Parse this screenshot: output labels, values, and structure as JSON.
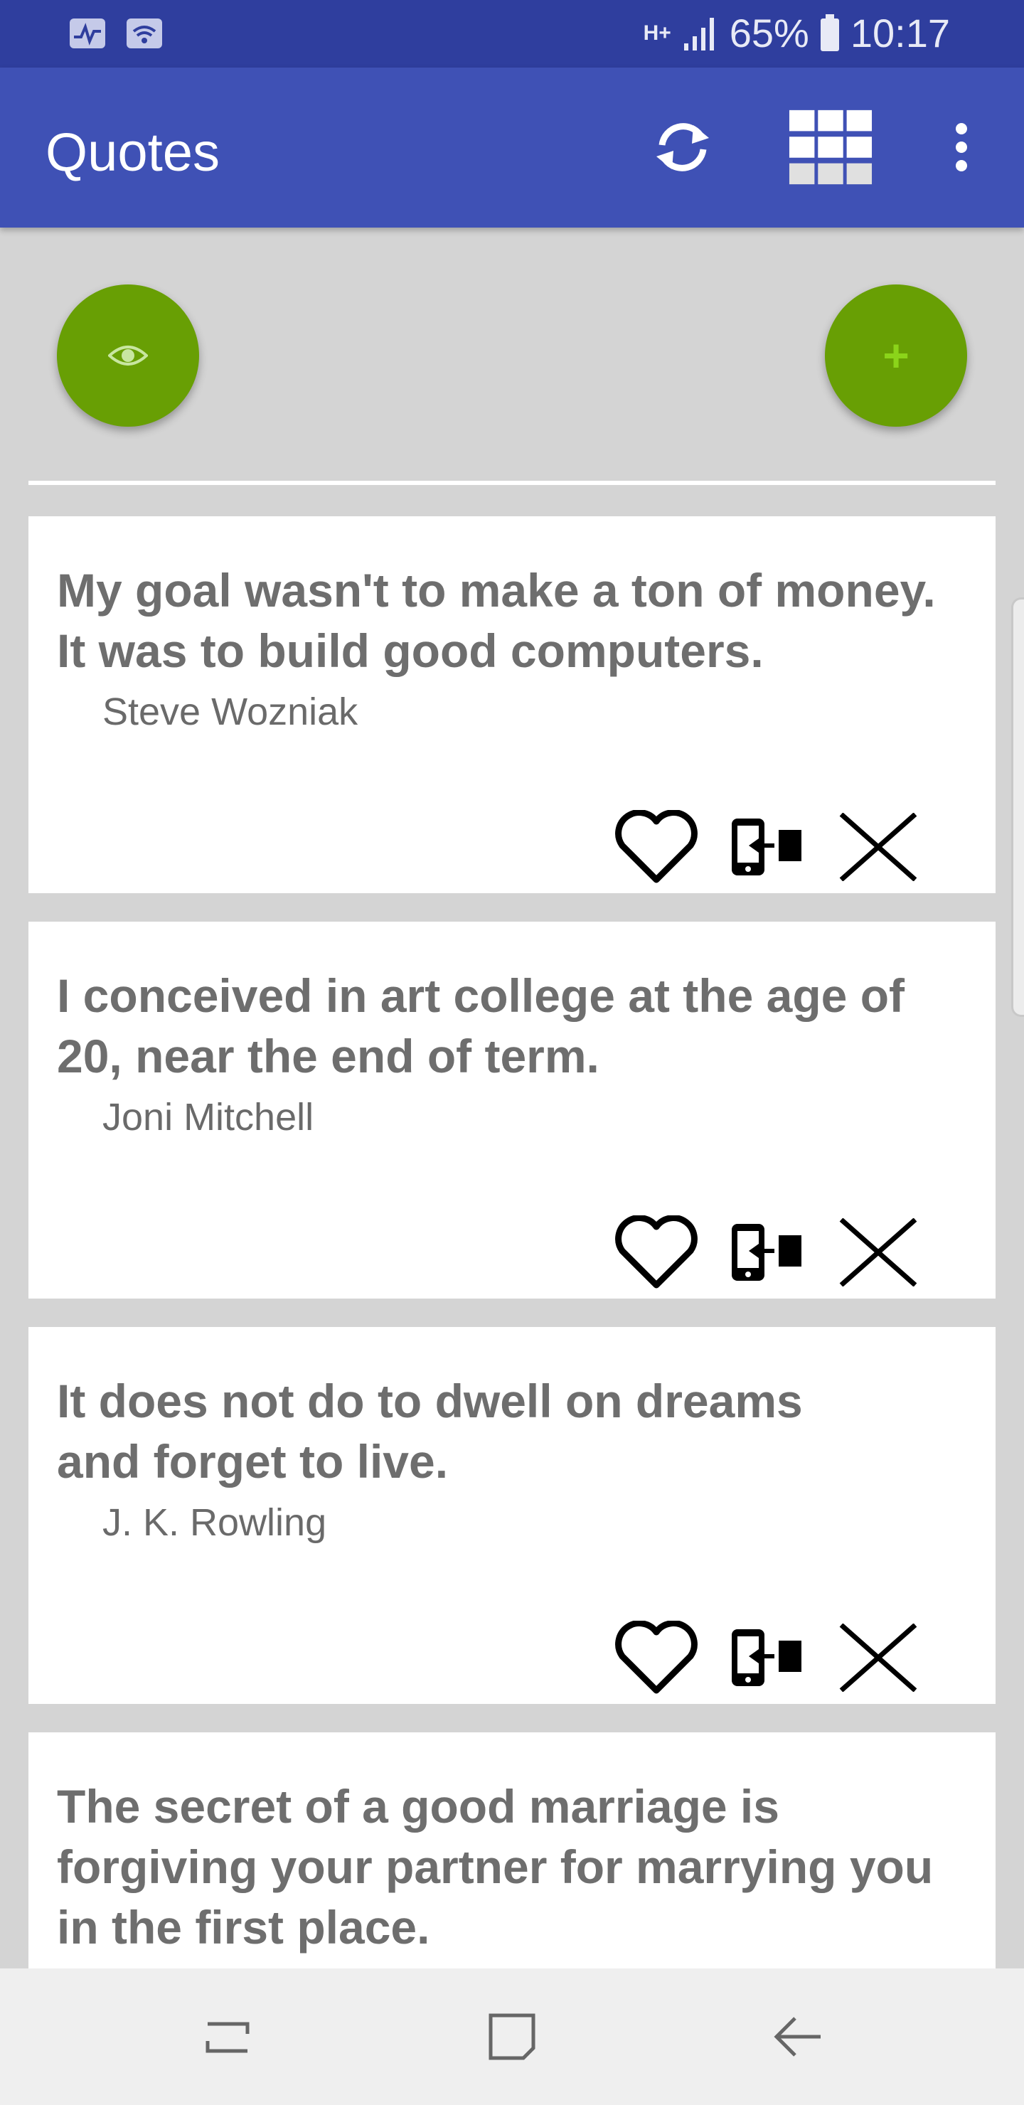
{
  "status_bar": {
    "network_type": "H+",
    "battery": "65%",
    "time": "10:17"
  },
  "app_bar": {
    "title": "Quotes",
    "icons": [
      "refresh-icon",
      "grid-view-icon",
      "more-vertical-icon"
    ]
  },
  "fabs": {
    "left_icon": "eye-icon",
    "right_icon": "plus-icon",
    "plus_glyph": "+"
  },
  "quotes": [
    {
      "text": "My goal wasn't to make a ton of money. It was to build good computers.",
      "author": "Steve Wozniak"
    },
    {
      "text": "I conceived in art college at the age of 20, near the end of term.",
      "author": "Joni Mitchell"
    },
    {
      "text": "It does not do to dwell on dreams and forget to live.",
      "author": "J. K. Rowling"
    },
    {
      "text": "The secret of a good marriage is forgiving your partner for marrying you in the first place.",
      "author": ""
    }
  ],
  "card_actions": [
    "heart-icon",
    "send-to-device-icon",
    "close-icon"
  ],
  "nav_bar": [
    "recents-icon",
    "home-icon",
    "back-icon"
  ],
  "colors": {
    "status_bar": "#2f3e9e",
    "app_bar": "#3f51b5",
    "fab": "#689f04",
    "background": "#d4d4d4",
    "quote_text": "#6e6e6e"
  }
}
